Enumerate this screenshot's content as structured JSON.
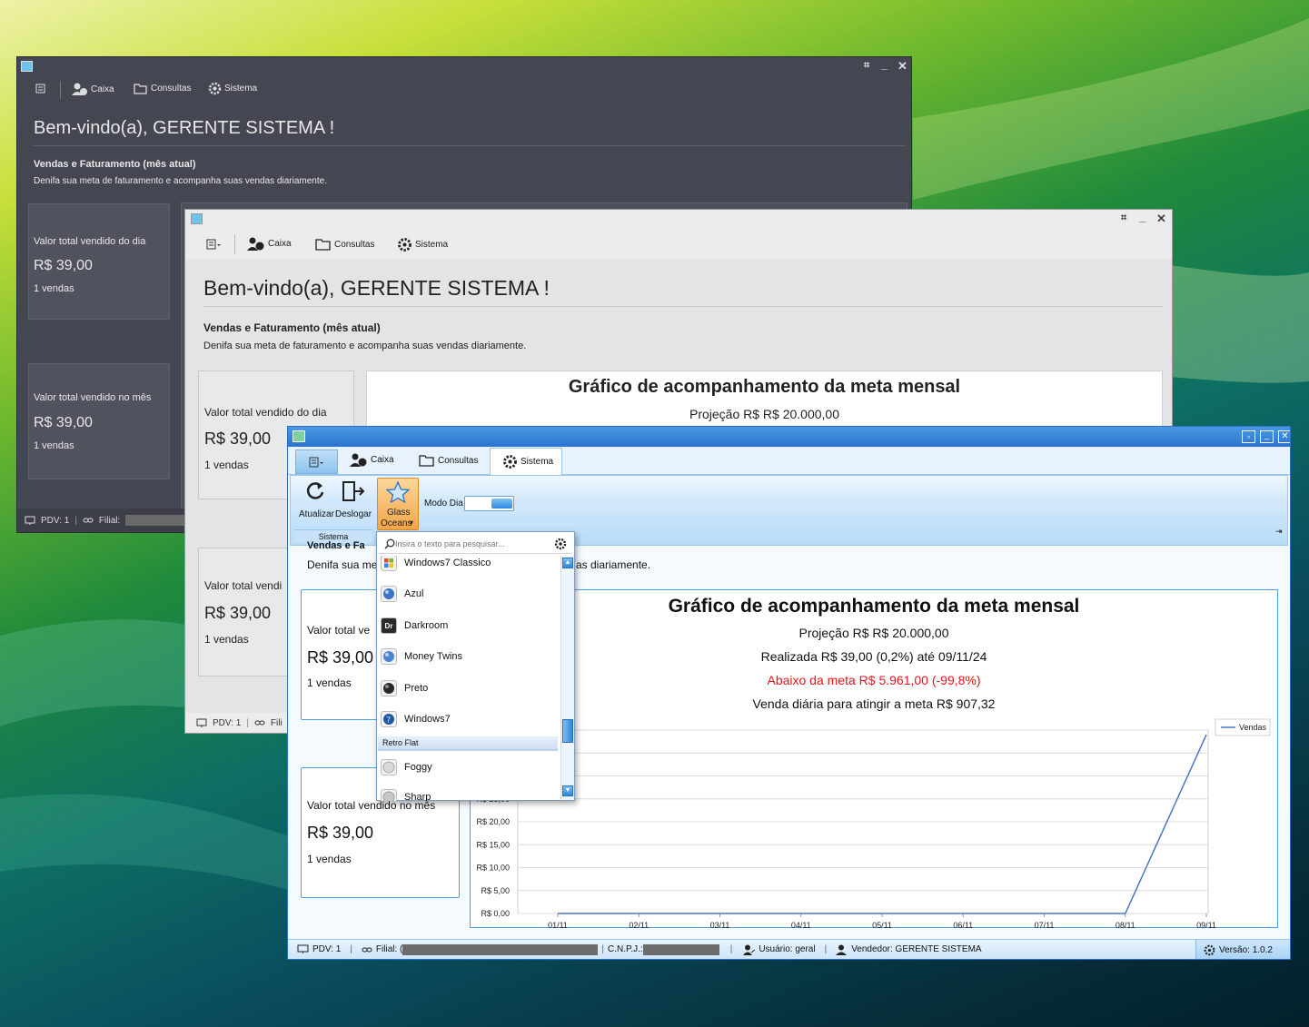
{
  "app": {
    "welcome": "Bem-vindo(a), GERENTE SISTEMA !",
    "section_title": "Vendas e Faturamento (mês atual)",
    "section_desc": "Denifa sua meta de faturamento e acompanha suas vendas diariamente.",
    "menu": {
      "caixa": "Caixa",
      "consultas": "Consultas",
      "sistema": "Sistema"
    },
    "day_card": {
      "title": "Valor total vendido do dia",
      "value": "R$ 39,00",
      "count": "1 vendas"
    },
    "month_card": {
      "title": "Valor total vendido no mês",
      "value": "R$ 39,00",
      "count": "1 vendas"
    }
  },
  "status": {
    "pdv": "PDV: 1",
    "filial": "Filial:",
    "filial_short": "Fili",
    "filial_clip": "Filial: (",
    "cnpj": "C.N.P.J.:",
    "usuario": "Usuário: geral",
    "vendedor": "Vendedor: GERENTE SISTEMA",
    "versao": "Versão: 1.0.2"
  },
  "ribbon": {
    "atualizar": "Atualizar",
    "deslogar": "Deslogar",
    "group": "Sistema",
    "theme_btn_l1": "Glass",
    "theme_btn_l2": "Oceans",
    "modo_dia": "Modo Dia"
  },
  "dropdown": {
    "placeholder": "Insira o texto para pesquisar...",
    "items": [
      "Windows7 Classico",
      "Azul",
      "Darkroom",
      "Money Twins",
      "Preto",
      "Windows7"
    ],
    "group_header": "Retro Flat",
    "group_items": [
      "Foggy",
      "Sharp"
    ]
  },
  "chart_texts": {
    "title": "Gráfico de acompanhamento da meta mensal",
    "projecao": "Projeção R$ R$ 20.000,00",
    "realizada": "Realizada R$ 39,00 (0,2%) até 09/11/24",
    "abaixo": "Abaixo da meta R$ 5.961,00 (-99,8%)",
    "venda_diaria": "Venda diária para atingir a meta R$ 907,32"
  },
  "chart_clip": {
    "partial_desc": "Denifa sua met",
    "partial_desc_tail": "as diariamente.",
    "partial_title": "Vendas e Fa",
    "partial_card_title": "Valor total ve",
    "partial_card_title_w2": "Valor total vendi",
    "partial_tick": "R$ 25,00"
  },
  "colors": {
    "abaixo": "#e8141b",
    "glass_border": "#2a70c6",
    "line": "#4a78c4"
  },
  "chart_data": {
    "type": "line",
    "categories": [
      "01/11",
      "02/11",
      "03/11",
      "04/11",
      "05/11",
      "06/11",
      "07/11",
      "08/11",
      "09/11"
    ],
    "series": [
      {
        "name": "Vendas",
        "values": [
          0,
          0,
          0,
          0,
          0,
          0,
          0,
          0,
          39
        ]
      }
    ],
    "y_ticks": [
      "R$ 0,00",
      "R$ 5,00",
      "R$ 10,00",
      "R$ 15,00",
      "R$ 20,00"
    ],
    "ylim": [
      0,
      40
    ],
    "legend": "top-right",
    "grid": true
  }
}
